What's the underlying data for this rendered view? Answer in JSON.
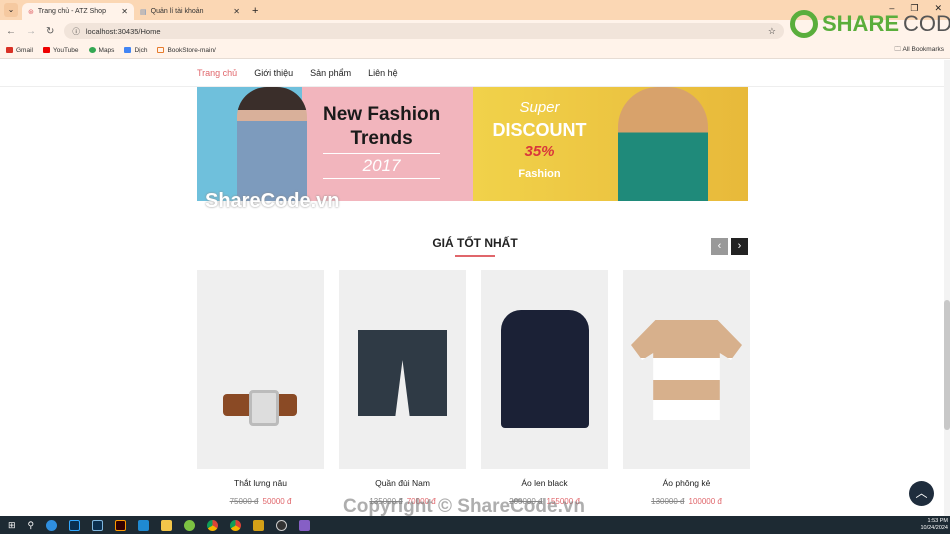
{
  "browser": {
    "tabs": [
      {
        "title": "Trang chủ - ATZ Shop",
        "active": true
      },
      {
        "title": "Quản lí tài khoản",
        "active": false
      }
    ],
    "url": "localhost:30435/Home",
    "bookmarks": [
      "Gmail",
      "YouTube",
      "Maps",
      "Dịch",
      "BookStore-main/"
    ],
    "all_bookmarks": "All Bookmarks"
  },
  "watermark": {
    "logo": "SHARECODE.vn",
    "banner": "ShareCode.vn",
    "footer": "Copyright © ShareCode.vn"
  },
  "nav": {
    "items": [
      {
        "label": "Trang chủ",
        "active": true
      },
      {
        "label": "Giới thiệu"
      },
      {
        "label": "Sản phẩm"
      },
      {
        "label": "Liên hệ"
      }
    ]
  },
  "banner": {
    "left": {
      "line1": "New Fashion",
      "line2": "Trends",
      "year": "2017"
    },
    "right": {
      "super": "Super",
      "discount": "DISCOUNT",
      "percent": "35%",
      "fashion": "Fashion"
    }
  },
  "section": {
    "title": "GIÁ TỐT NHẤT"
  },
  "products": [
    {
      "name": "Thắt lưng nâu",
      "old_price": "75000 đ",
      "price": "50000 đ"
    },
    {
      "name": "Quần đùi Nam",
      "old_price": "135000 đ",
      "price": "70000 đ"
    },
    {
      "name": "Áo len black",
      "old_price": "200000 đ",
      "price": "155000 đ"
    },
    {
      "name": "Áo phông kẻ",
      "old_price": "130000 đ",
      "price": "100000 đ"
    }
  ],
  "taskbar": {
    "time": "1:53 PM",
    "date": "10/24/2024"
  },
  "colors": {
    "accent": "#e0666b",
    "tabbar": "#fbd7b4"
  }
}
